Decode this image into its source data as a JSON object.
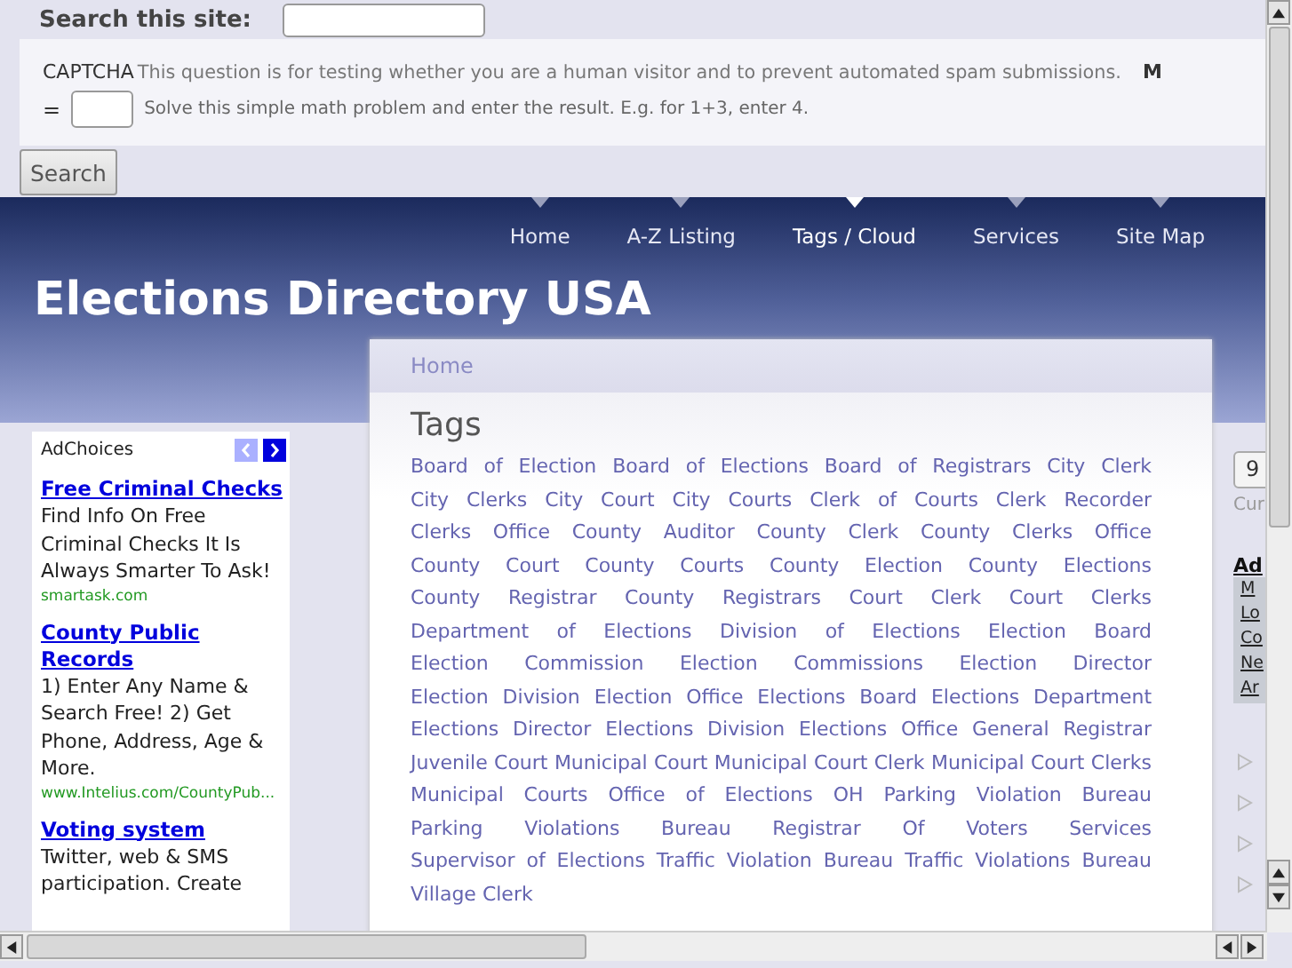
{
  "search_form": {
    "label": "Search this site:",
    "captcha_label": "CAPTCHA",
    "captcha_description": "This question is for testing whether you are a human visitor and to prevent automated spam submissions.",
    "captcha_cut": "M",
    "equals": "=",
    "captcha_hint": "Solve this simple math problem and enter the result. E.g. for 1+3, enter 4.",
    "button": "Search"
  },
  "nav": [
    {
      "label": "Home",
      "selected": false
    },
    {
      "label": "A-Z Listing",
      "selected": false
    },
    {
      "label": "Tags / Cloud",
      "selected": true
    },
    {
      "label": "Services",
      "selected": false
    },
    {
      "label": "Site Map",
      "selected": false
    }
  ],
  "site_title": "Elections Directory USA",
  "breadcrumb": "Home",
  "heading": "Tags",
  "tags": [
    "Board of Election",
    "Board of Elections",
    "Board of Registrars",
    "City Clerk",
    "City Clerks",
    "City Court",
    "City Courts",
    "Clerk of Courts",
    "Clerk Recorder",
    "Clerks Office",
    "County Auditor",
    "County Clerk",
    "County Clerks Office",
    "County Court",
    "County Courts",
    "County Election",
    "County Elections",
    "County Registrar",
    "County Registrars",
    "Court Clerk",
    "Court Clerks",
    "Department of Elections",
    "Division of Elections",
    "Election Board",
    "Election Commission",
    "Election Commissions",
    "Election Director",
    "Election Division",
    "Election Office",
    "Elections Board",
    "Elections Department",
    "Elections Director",
    "Elections Division",
    "Elections Office",
    "General Registrar",
    "Juvenile Court",
    "Municipal Court",
    "Municipal Court Clerk",
    "Municipal Court Clerks",
    "Municipal Courts",
    "Office of Elections",
    "OH",
    "Parking Violation Bureau",
    "Parking Violations Bureau",
    "Registrar Of Voters",
    "Services",
    "Supervisor of Elections",
    "Traffic Violation Bureau",
    "Traffic Violations Bureau",
    "Village Clerk"
  ],
  "ads": {
    "adchoices": "AdChoices",
    "items": [
      {
        "title": "Free Criminal Checks",
        "text": "Find Info On Free Criminal Checks It Is Always Smarter To Ask!",
        "url": "smartask.com"
      },
      {
        "title": "County Public Records",
        "text": "1) Enter Any Name & Search Free! 2) Get Phone, Address, Age & More.",
        "url": "www.Intelius.com/CountyPub..."
      },
      {
        "title": "Voting system",
        "text": "Twitter, web & SMS participation. Create"
      }
    ]
  },
  "right_column": {
    "button": "9",
    "caption": "Cur",
    "box_title": "Ad",
    "links": [
      "M",
      "Lo",
      "Co",
      "Ne",
      "Ar"
    ]
  }
}
